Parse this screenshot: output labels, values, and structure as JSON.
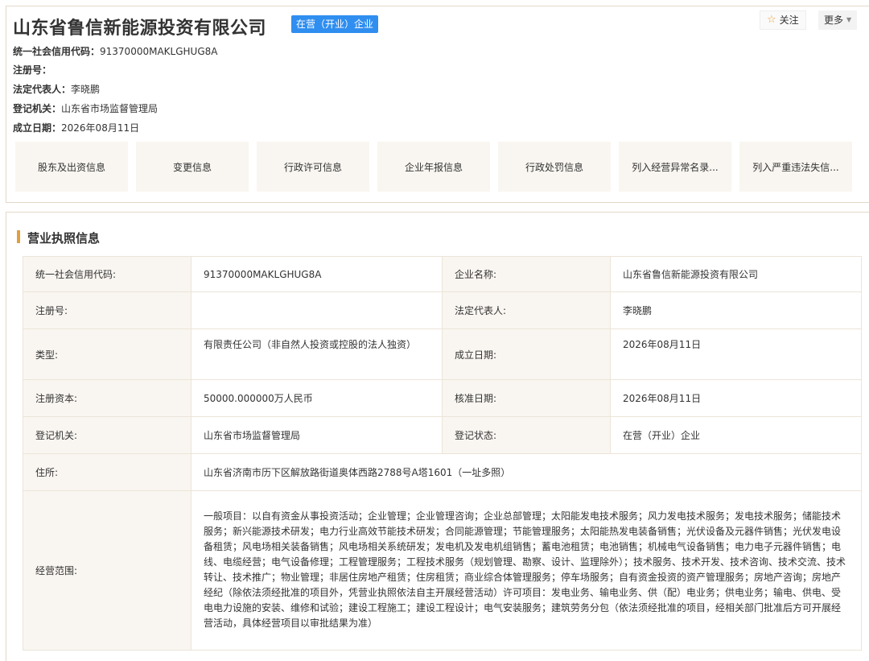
{
  "company": {
    "name": "山东省鲁信新能源投资有限公司",
    "status_badge": "在营（开业）企业",
    "meta": [
      {
        "label": "统一社会信用代码：",
        "value": "91370000MAKLGHUG8A"
      },
      {
        "label": "注册号：",
        "value": ""
      },
      {
        "label": "法定代表人：",
        "value": "李晓鹏"
      },
      {
        "label": "登记机关：",
        "value": "山东省市场监督管理局"
      },
      {
        "label": "成立日期：",
        "value": "2026年08月11日"
      }
    ]
  },
  "actions": {
    "follow_label": "关注",
    "follow_icon": "star-outline-icon",
    "more_label": "更多",
    "more_icon": "triangle-down-icon"
  },
  "tabs": [
    {
      "label": "股东及出资信息"
    },
    {
      "label": "变更信息"
    },
    {
      "label": "行政许可信息"
    },
    {
      "label": "企业年报信息"
    },
    {
      "label": "行政处罚信息"
    },
    {
      "label": "列入经营异常名录..."
    },
    {
      "label": "列入严重违法失信..."
    }
  ],
  "license": {
    "section_title": "营业执照信息",
    "accent_color": "#e0a040",
    "rows": {
      "credit_code": {
        "label": "统一社会信用代码:",
        "value": "91370000MAKLGHUG8A"
      },
      "company_name": {
        "label": "企业名称:",
        "value": "山东省鲁信新能源投资有限公司"
      },
      "reg_no": {
        "label": "注册号:",
        "value": ""
      },
      "legal_rep": {
        "label": "法定代表人:",
        "value": "李晓鹏"
      },
      "type": {
        "label": "类型:",
        "value": "有限责任公司（非自然人投资或控股的法人独资）"
      },
      "found_date": {
        "label": "成立日期:",
        "value": "2026年08月11日"
      },
      "capital": {
        "label": "注册资本:",
        "value": "50000.000000万人民币"
      },
      "approval_date": {
        "label": "核准日期:",
        "value": "2026年08月11日"
      },
      "authority": {
        "label": "登记机关:",
        "value": "山东省市场监督管理局"
      },
      "reg_status": {
        "label": "登记状态:",
        "value": "在营（开业）企业"
      },
      "address": {
        "label": "住所:",
        "value": "山东省济南市历下区解放路街道奥体西路2788号A塔1601（一址多照）"
      },
      "scope": {
        "label": "经营范围:",
        "value": "一般项目：以自有资金从事投资活动；企业管理；企业管理咨询；企业总部管理；太阳能发电技术服务；风力发电技术服务；发电技术服务；储能技术服务；新兴能源技术研发；电力行业高效节能技术研发；合同能源管理；节能管理服务；太阳能热发电装备销售；光伏设备及元器件销售；光伏发电设备租赁；风电场相关装备销售；风电场相关系统研发；发电机及发电机组销售；蓄电池租赁；电池销售；机械电气设备销售；电力电子元器件销售；电线、电缆经营；电气设备修理；工程管理服务；工程技术服务（规划管理、勘察、设计、监理除外）；技术服务、技术开发、技术咨询、技术交流、技术转让、技术推广；物业管理；非居住房地产租赁；住房租赁；商业综合体管理服务；停车场服务；自有资金投资的资产管理服务；房地产咨询；房地产经纪（除依法须经批准的项目外，凭营业执照依法自主开展经营活动）许可项目：发电业务、输电业务、供（配）电业务；供电业务；输电、供电、受电电力设施的安装、维修和试验；建设工程施工；建设工程设计；电气安装服务；建筑劳务分包（依法须经批准的项目，经相关部门批准后方可开展经营活动，具体经营项目以审批结果为准）"
      }
    }
  }
}
